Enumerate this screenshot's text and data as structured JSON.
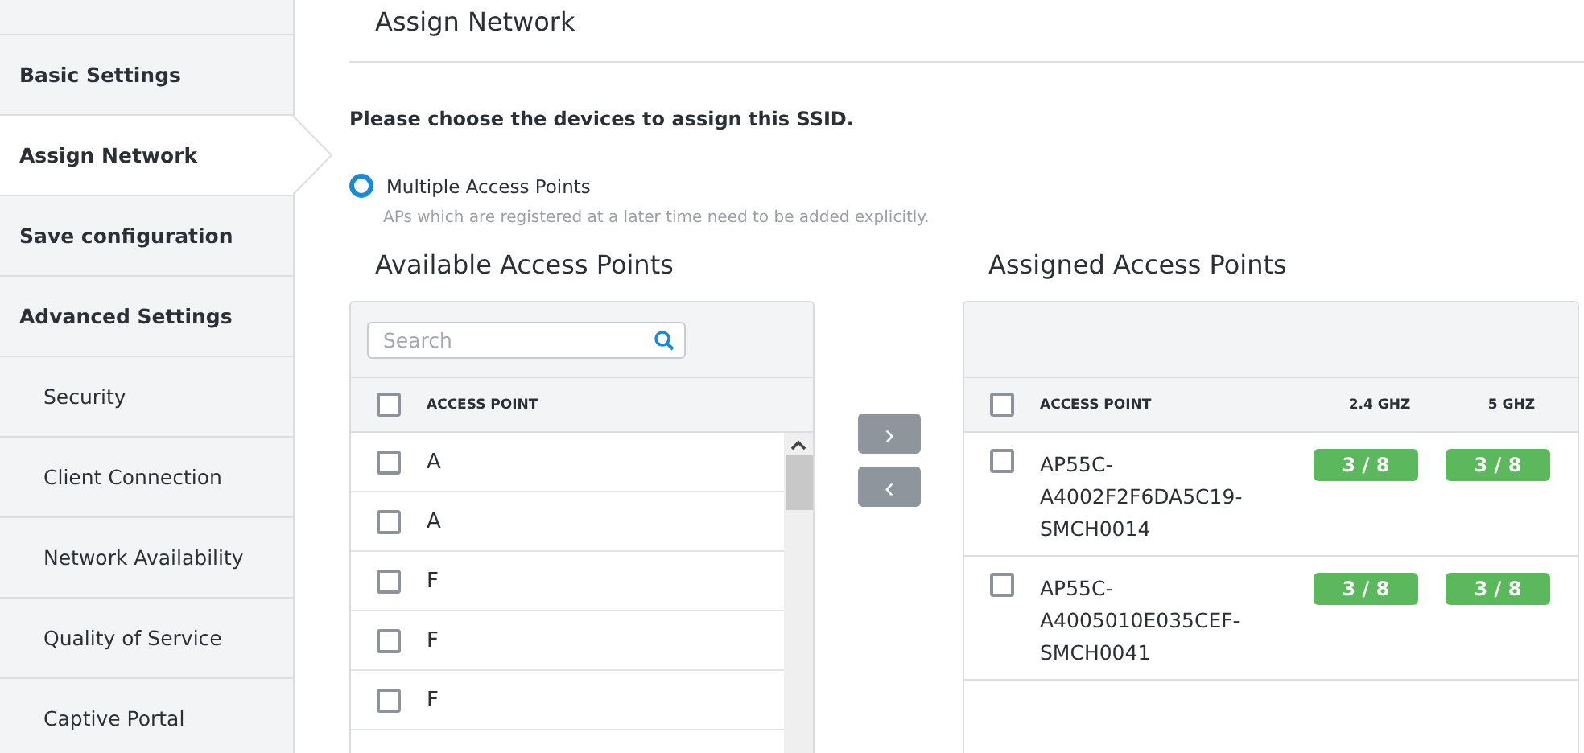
{
  "sidebar": {
    "items": [
      {
        "label": "Basic Settings",
        "kind": "main",
        "selected": false
      },
      {
        "label": "Assign Network",
        "kind": "main",
        "selected": true
      },
      {
        "label": "Save configuration",
        "kind": "main",
        "selected": false
      },
      {
        "label": "Advanced Settings",
        "kind": "main",
        "selected": false
      },
      {
        "label": "Security",
        "kind": "sub",
        "selected": false
      },
      {
        "label": "Client Connection",
        "kind": "sub",
        "selected": false
      },
      {
        "label": "Network Availability",
        "kind": "sub",
        "selected": false
      },
      {
        "label": "Quality of Service",
        "kind": "sub",
        "selected": false
      },
      {
        "label": "Captive Portal",
        "kind": "sub",
        "selected": false
      }
    ]
  },
  "page_title": "Assign Network",
  "instruction": "Please choose the devices to assign this SSID.",
  "radio": {
    "label": "Multiple Access Points",
    "selected": true,
    "hint": "APs which are registered at a later time need to be added explicitly."
  },
  "available": {
    "title": "Available Access Points",
    "search": {
      "placeholder": "Search"
    },
    "select_all": {
      "checked": false
    },
    "columns": [
      "ACCESS POINT"
    ],
    "rows": [
      {
        "name": "A",
        "checked": false
      },
      {
        "name": "A",
        "checked": false
      },
      {
        "name": "F",
        "checked": false
      },
      {
        "name": "F",
        "checked": false
      },
      {
        "name": "F",
        "checked": false
      }
    ]
  },
  "move_buttons": [
    {
      "label": "›",
      "disabled": true
    },
    {
      "label": "‹",
      "disabled": true
    }
  ],
  "assigned": {
    "title": "Assigned Access Points",
    "select_all": {
      "checked": false
    },
    "columns": [
      "ACCESS POINT",
      "2.4 GHZ",
      "5 GHZ"
    ],
    "rows": [
      {
        "name": "AP55C-A4002F2F6DA5C19-SMCH0014",
        "checked": false,
        "band_24": "3 / 8",
        "band_5": "3 / 8"
      },
      {
        "name": "AP55C-A4005010E035CEF-SMCH0041",
        "checked": false,
        "band_24": "3 / 8",
        "band_5": "3 / 8"
      }
    ]
  }
}
